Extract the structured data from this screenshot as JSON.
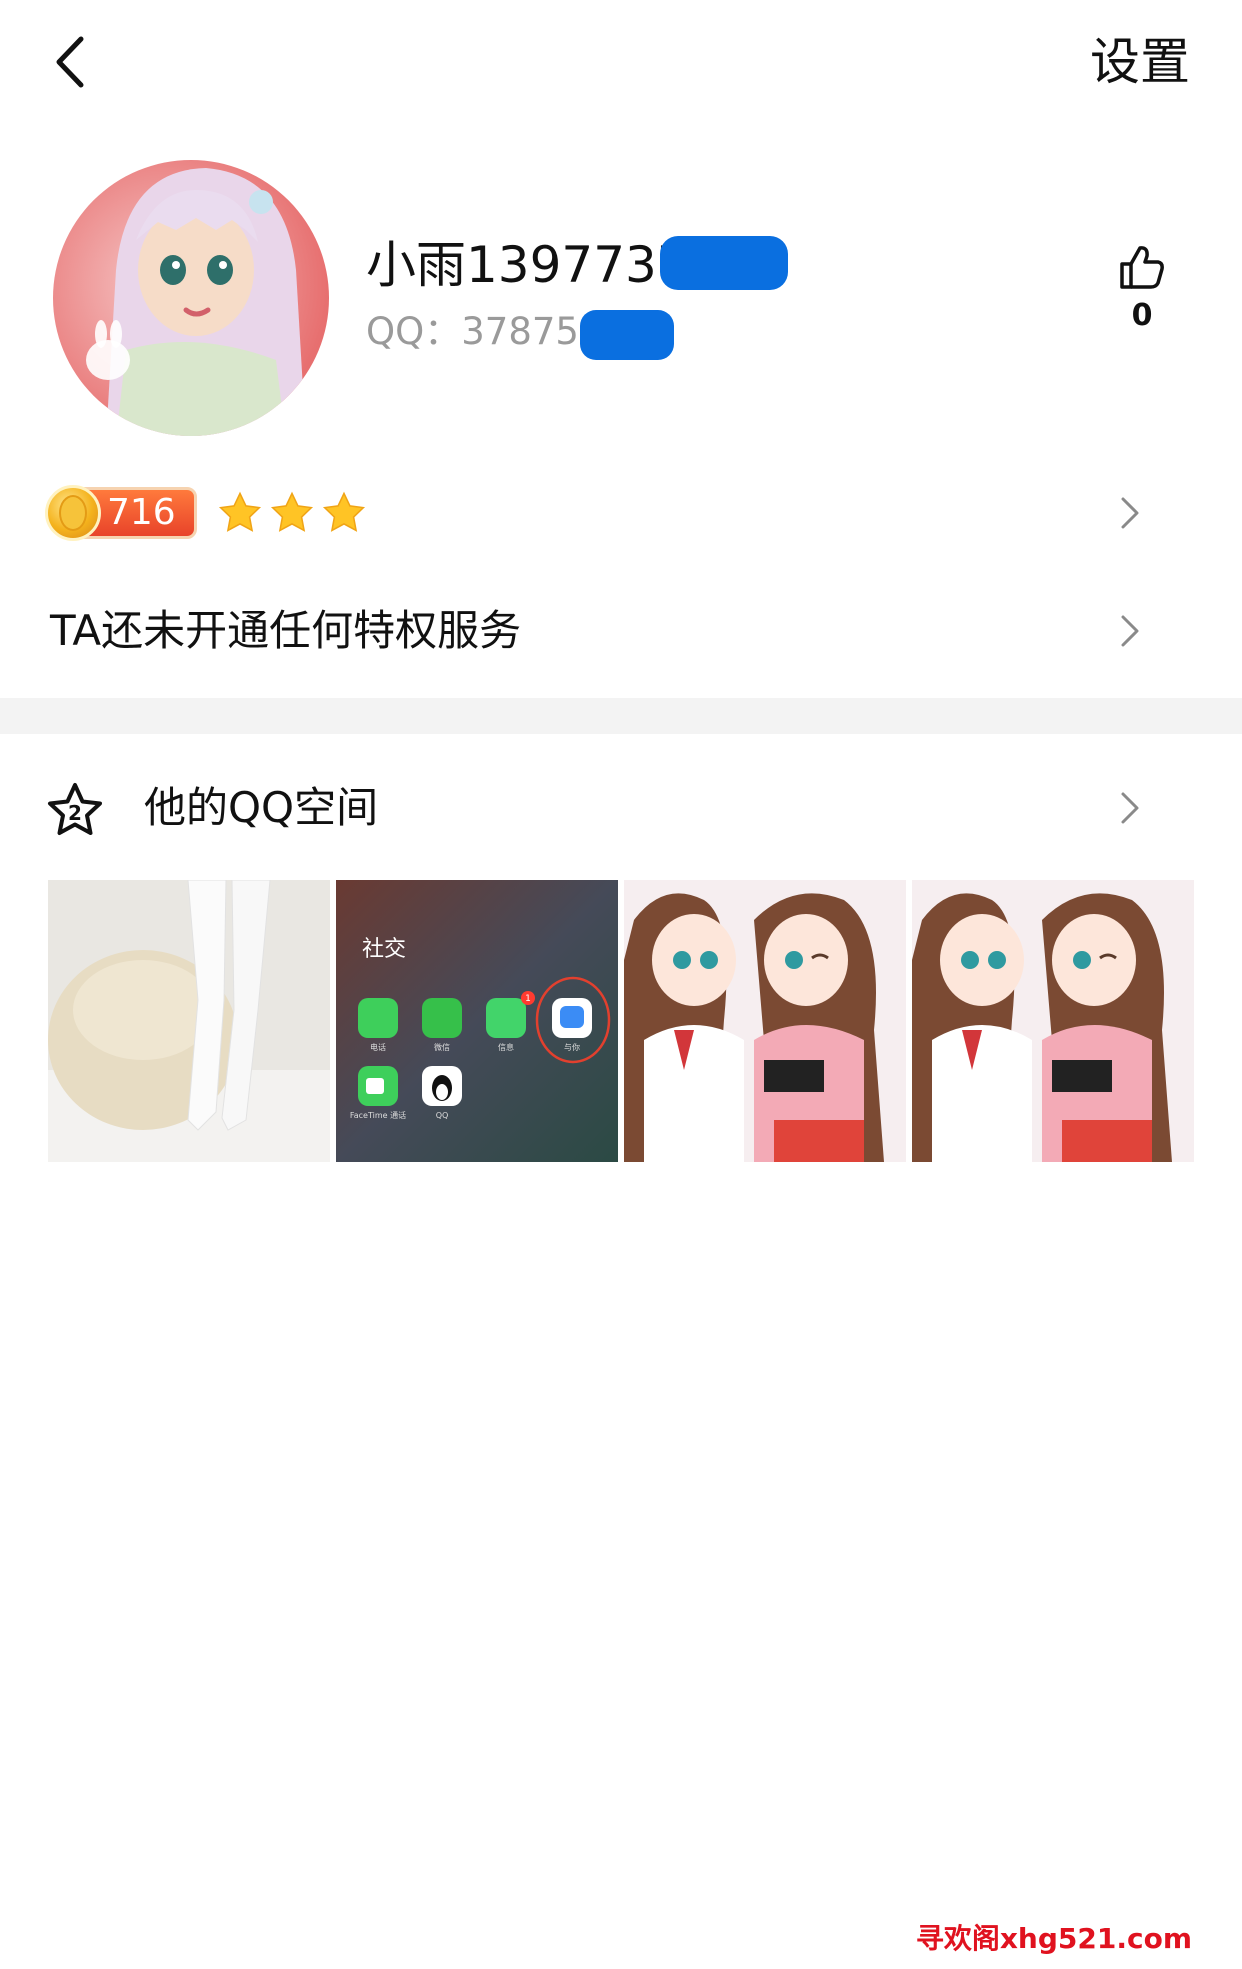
{
  "header": {
    "settings_label": "设置"
  },
  "profile": {
    "nickname": "小雨1397737",
    "qq_label": "QQ：378756",
    "like_count": "0"
  },
  "level": {
    "value": "716",
    "stars": 3
  },
  "privilege": {
    "text": "TA还未开通任何特权服务"
  },
  "qzone": {
    "label": "他的QQ空间",
    "photos": [
      {
        "name": "photo-white-tights"
      },
      {
        "name": "photo-phone-social-folder",
        "folder_title": "社交",
        "apps": [
          "电话",
          "微信",
          "信息",
          "与你",
          "FaceTime 通话",
          "QQ"
        ],
        "badge": "1"
      },
      {
        "name": "photo-anime-girls"
      },
      {
        "name": "photo-anime-girls-2"
      }
    ]
  },
  "watermark": "寻欢阁xhg521.com",
  "colors": {
    "accent_orange": "#e8432a",
    "text_primary": "#111111",
    "text_secondary": "#9a9a9a",
    "section_gap": "#f3f3f3",
    "redaction": "#0a6fe0"
  }
}
